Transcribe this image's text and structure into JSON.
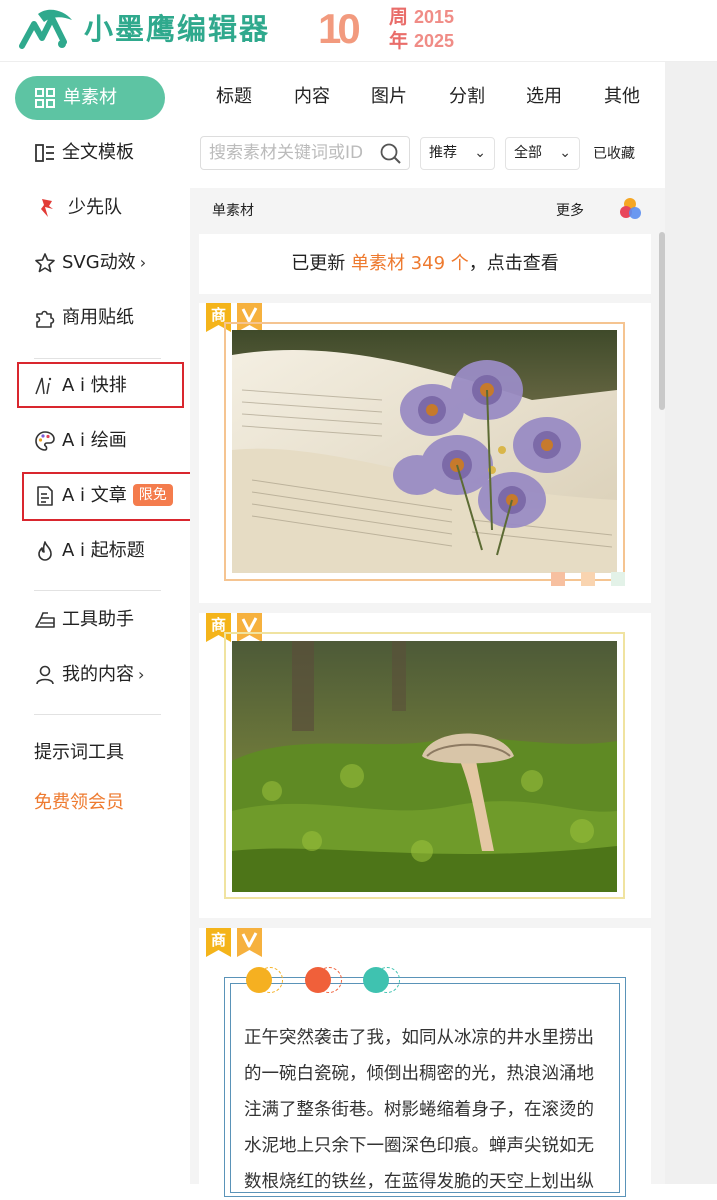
{
  "header": {
    "brand": "小墨鹰编辑器",
    "anniversary_number": "10",
    "anniversary_char1": "周",
    "anniversary_char2": "年",
    "year_start": "2015",
    "year_end": "2025"
  },
  "sidebar": {
    "active_label": "单素材",
    "items": [
      {
        "label": "全文模板"
      },
      {
        "label": "少先队"
      },
      {
        "label": "SVG动效"
      },
      {
        "label": "商用贴纸"
      },
      {
        "label": "A i 快排"
      },
      {
        "label": "A i 绘画"
      },
      {
        "label": "A i 文章"
      },
      {
        "label": "A i 起标题"
      },
      {
        "label": "工具助手"
      },
      {
        "label": "我的内容"
      }
    ],
    "chevron": "›",
    "badge_free": "限免",
    "prompt_tool": "提示词工具",
    "free_vip": "免费领会员"
  },
  "tabs": [
    "标题",
    "内容",
    "图片",
    "分割",
    "选用",
    "其他"
  ],
  "search": {
    "placeholder": "搜索素材关键词或ID",
    "value": ""
  },
  "filters": {
    "sort": "推荐",
    "scope": "全部",
    "collected": "已收藏",
    "caret": "⌄"
  },
  "content": {
    "section_title": "单素材",
    "more": "更多",
    "notice_prefix": "已更新",
    "notice_highlight": "单素材 349 个",
    "notice_suffix": "，点击查看",
    "tag_commercial": "商",
    "article_text": "正午突然袭击了我，如同从冰凉的井水里捞出的一碗白瓷碗，倾倒出稠密的光，热浪汹涌地注满了整条街巷。树影蜷缩着身子，在滚烫的水泥地上只余下一圈深色印痕。蝉声尖锐如无数根烧红的铁丝，在蓝得发脆的天空上划出纵"
  },
  "colors": {
    "brand_green": "#2fa98d",
    "active_green": "#5dc4a3",
    "accent_orange": "#ee7a2f",
    "highlight_red": "#d9262e",
    "vip_orange": "#ee7a2f"
  }
}
